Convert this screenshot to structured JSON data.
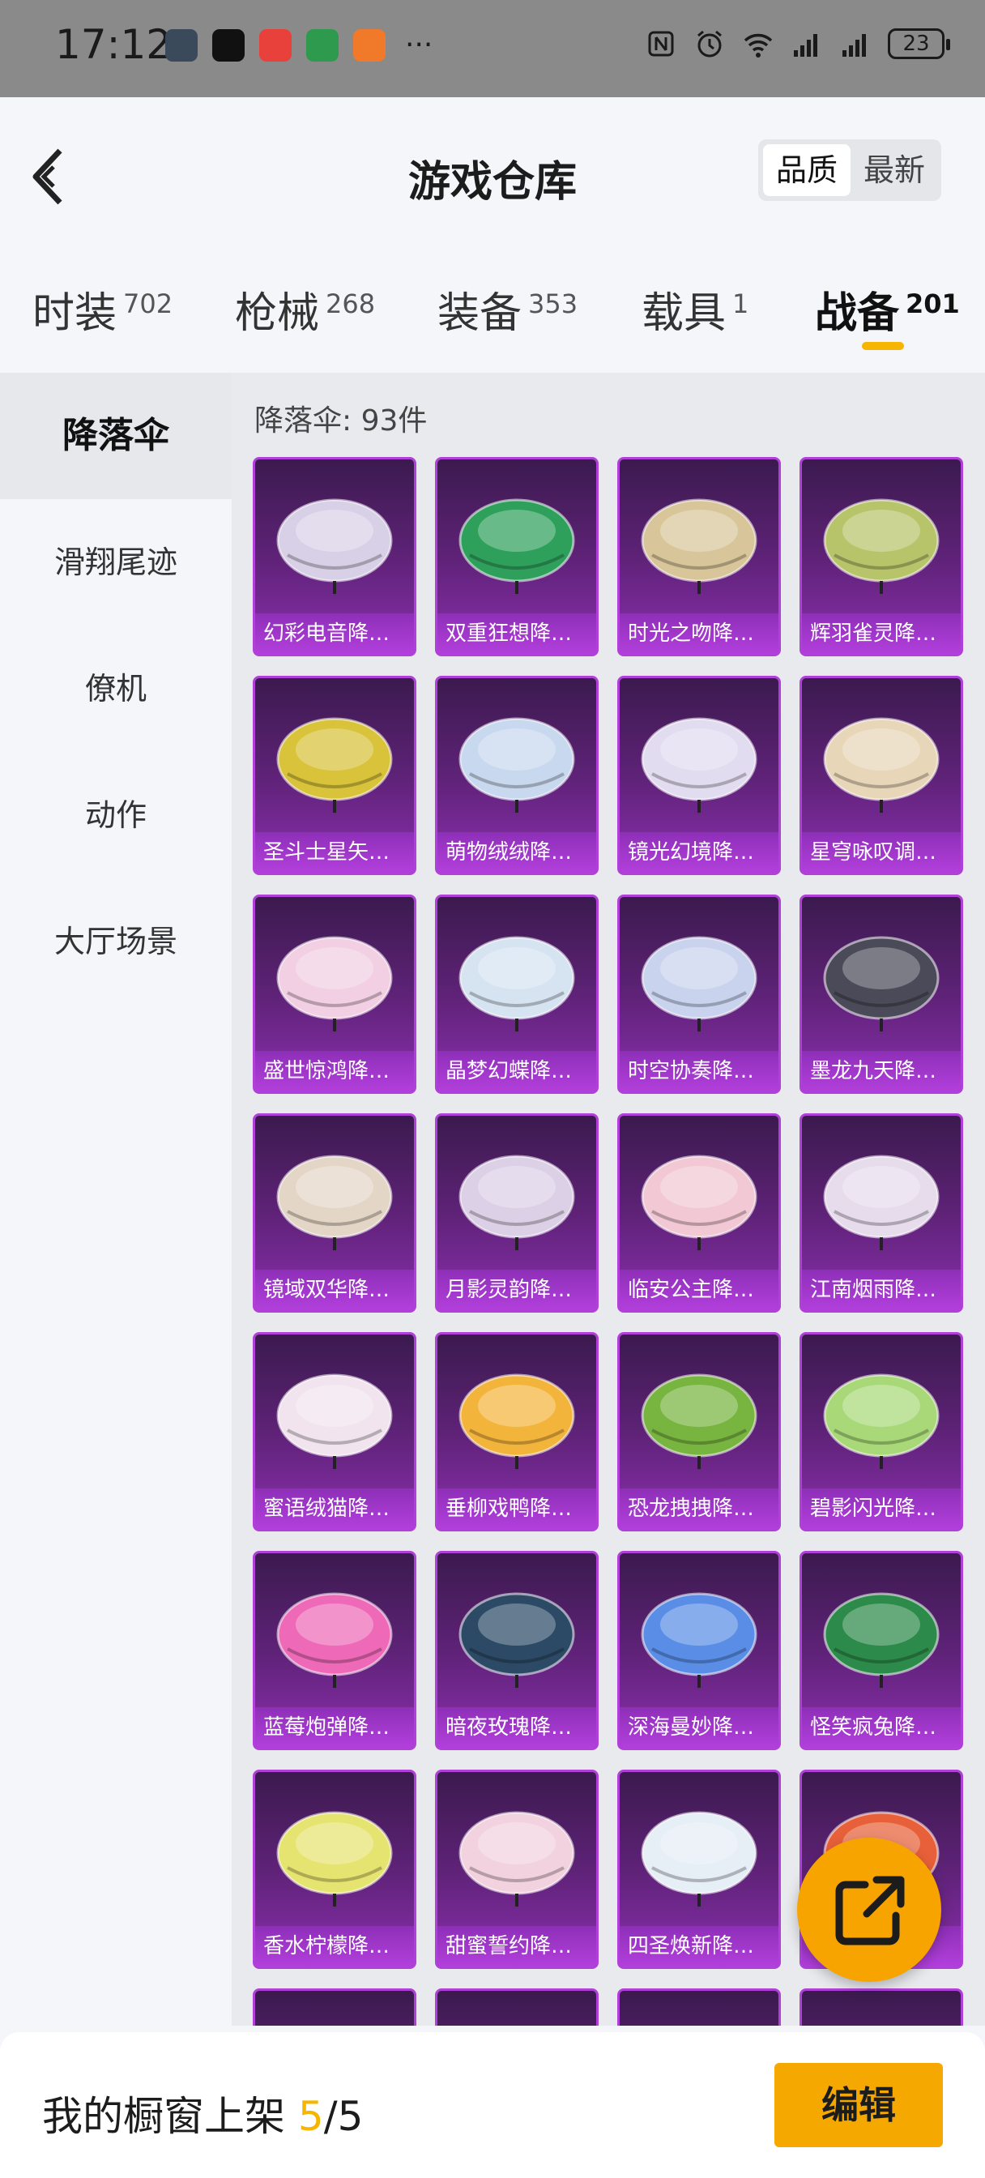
{
  "status": {
    "time": "17:12",
    "battery": "23",
    "more": "···"
  },
  "header": {
    "title": "游戏仓库",
    "sort_quality": "品质",
    "sort_latest": "最新"
  },
  "tabs": [
    {
      "label": "时装",
      "count": "702"
    },
    {
      "label": "枪械",
      "count": "268"
    },
    {
      "label": "装备",
      "count": "353"
    },
    {
      "label": "载具",
      "count": "1"
    },
    {
      "label": "战备",
      "count": "201"
    }
  ],
  "sidebar": [
    "降落伞",
    "滑翔尾迹",
    "僚机",
    "动作",
    "大厅场景"
  ],
  "content": {
    "count_label": "降落伞: 93件",
    "items": [
      {
        "name": "幻彩电音降…",
        "color": "#d8d0e6"
      },
      {
        "name": "双重狂想降…",
        "color": "#2fa05c"
      },
      {
        "name": "时光之吻降…",
        "color": "#d8c69a"
      },
      {
        "name": "辉羽雀灵降…",
        "color": "#b7c46a"
      },
      {
        "name": "圣斗士星矢…",
        "color": "#d8c33a"
      },
      {
        "name": "萌物绒绒降…",
        "color": "#c8d8ee"
      },
      {
        "name": "镜光幻境降…",
        "color": "#e2dcf0"
      },
      {
        "name": "星穹咏叹调…",
        "color": "#e8d6b8"
      },
      {
        "name": "盛世惊鸿降…",
        "color": "#f2cfe2"
      },
      {
        "name": "晶梦幻蝶降…",
        "color": "#d6e4f2"
      },
      {
        "name": "时空协奏降…",
        "color": "#c9d3ee"
      },
      {
        "name": "墨龙九天降…",
        "color": "#4a4a58"
      },
      {
        "name": "镜域双华降…",
        "color": "#e4d6c6"
      },
      {
        "name": "月影灵韵降…",
        "color": "#dcd0e6"
      },
      {
        "name": "临安公主降…",
        "color": "#f2c8d4"
      },
      {
        "name": "江南烟雨降…",
        "color": "#e6dcec"
      },
      {
        "name": "蜜语绒猫降…",
        "color": "#f2e4ee"
      },
      {
        "name": "垂柳戏鸭降…",
        "color": "#f3b43c"
      },
      {
        "name": "恐龙拽拽降…",
        "color": "#78b440"
      },
      {
        "name": "碧影闪光降…",
        "color": "#a8d878"
      },
      {
        "name": "蓝莓炮弹降…",
        "color": "#ee6ab8"
      },
      {
        "name": "暗夜玫瑰降…",
        "color": "#2c4a66"
      },
      {
        "name": "深海曼妙降…",
        "color": "#5a8ee6"
      },
      {
        "name": "怪笑疯兔降…",
        "color": "#2c8a4a"
      },
      {
        "name": "香水柠檬降…",
        "color": "#e6e470"
      },
      {
        "name": "甜蜜誓约降…",
        "color": "#f2d2de"
      },
      {
        "name": "四圣焕新降…",
        "color": "#e6eef6"
      },
      {
        "name": "",
        "color": "#e8603a"
      },
      {
        "name": "",
        "color": "#4a5a6a"
      },
      {
        "name": "",
        "color": "#d6d0e0"
      },
      {
        "name": "",
        "color": "#e8c04a"
      },
      {
        "name": "",
        "color": "#c04a4a"
      }
    ]
  },
  "bottom": {
    "label": "我的橱窗上架 ",
    "count": "5",
    "total": "/5",
    "edit": "编辑"
  }
}
